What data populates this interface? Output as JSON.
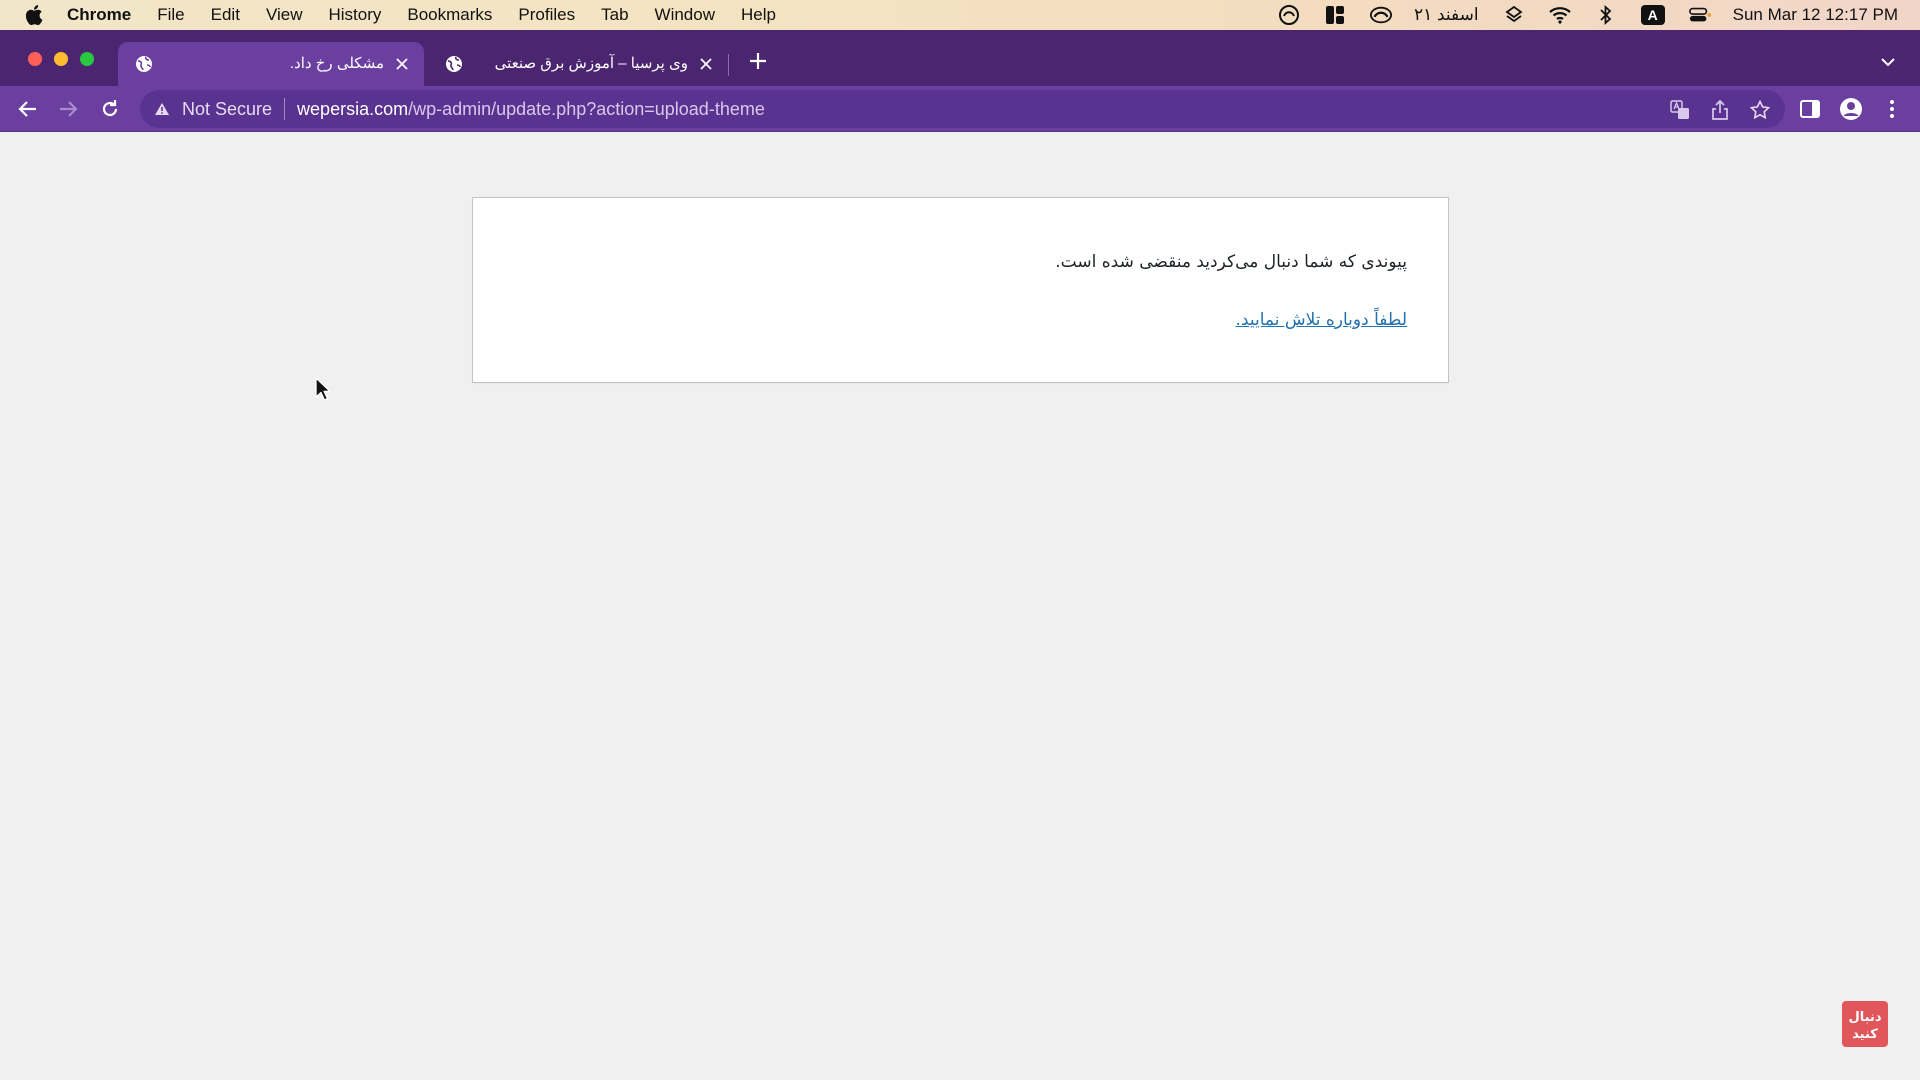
{
  "menubar": {
    "app_name": "Chrome",
    "items": [
      "File",
      "Edit",
      "View",
      "History",
      "Bookmarks",
      "Profiles",
      "Tab",
      "Window",
      "Help"
    ],
    "persian_date": "۲۱ اسفند",
    "input_source": "A",
    "clock": "Sun Mar 12  12:17 PM"
  },
  "tabs": [
    {
      "title": "مشکلی رخ داد.",
      "active": true
    },
    {
      "title": "وی پرسیا – آموزش برق صنعتی",
      "active": false
    }
  ],
  "omnibox": {
    "security_label": "Not Secure",
    "url_host": "wepersia.com",
    "url_path": "/wp-admin/update.php?action=upload-theme"
  },
  "page": {
    "message": "پیوندی که شما دنبال می‌کردید منقضی شده است.",
    "retry_link": "لطفاً دوباره تلاش نمایید."
  },
  "colors": {
    "tab_strip": "#4b2570",
    "toolbar": "#6b3fa0",
    "link": "#2271b1",
    "page_bg": "#f0f0f1"
  }
}
